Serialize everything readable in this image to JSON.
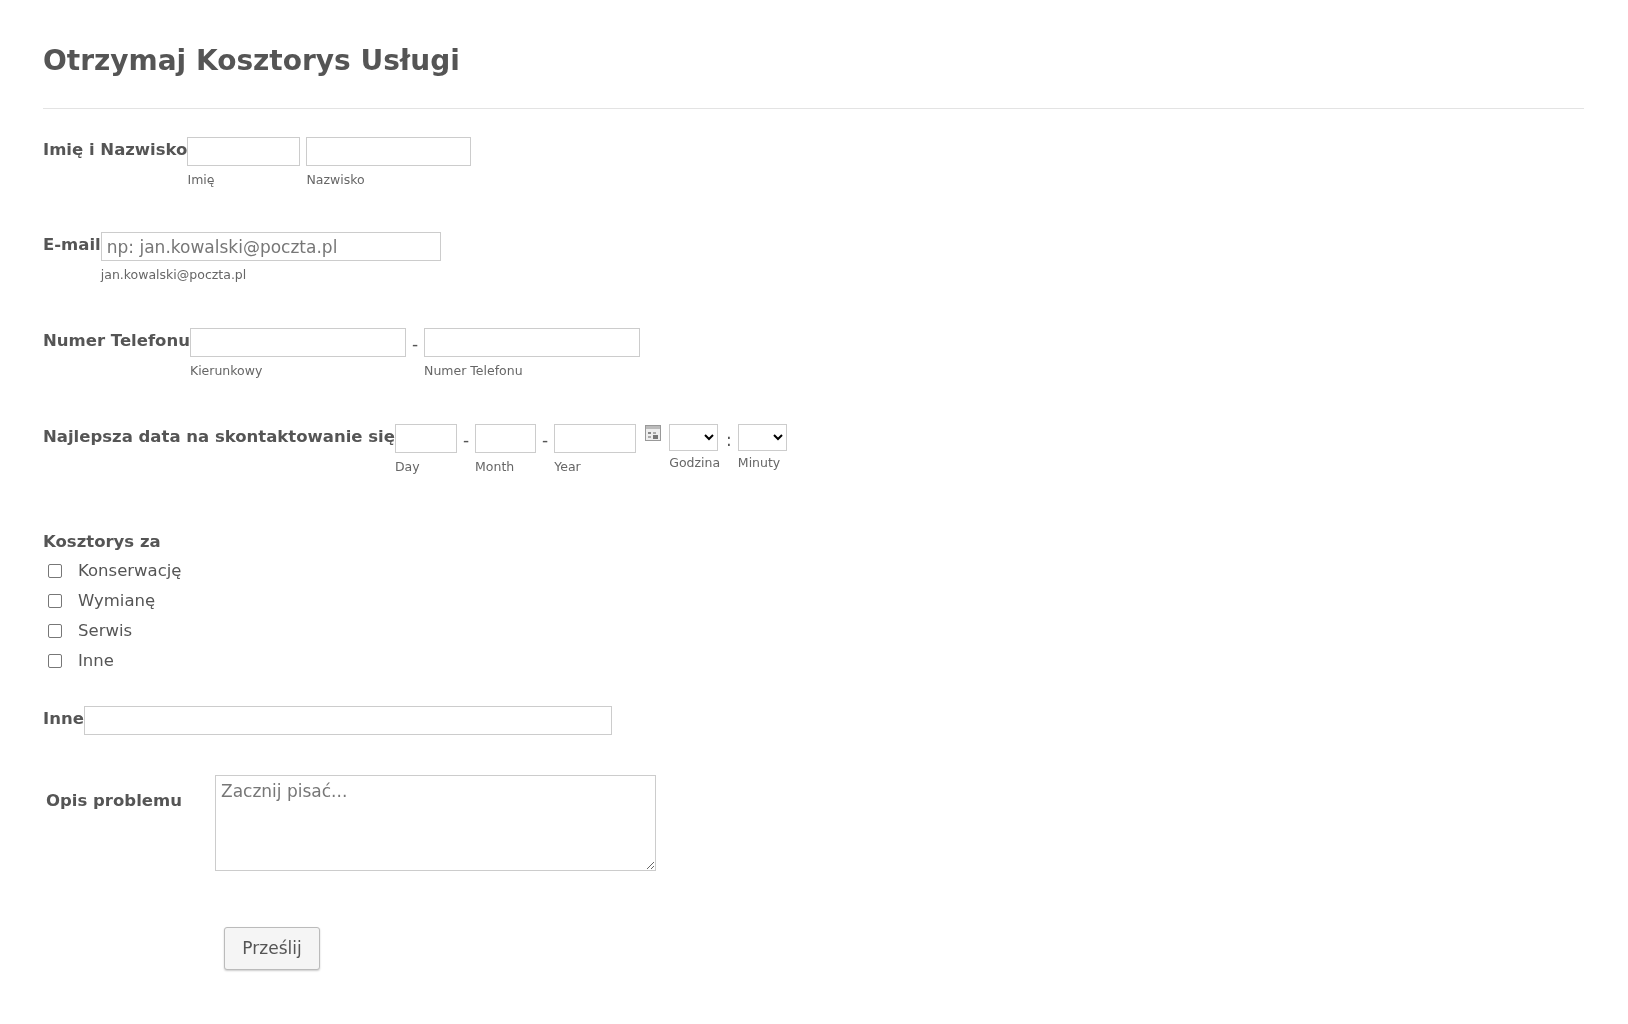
{
  "title": "Otrzymaj Kosztorys Usługi",
  "fields": [
    {
      "kind": "group",
      "label": "Imię i Nazwisko",
      "inputs": [
        {
          "sublabel": "Imię"
        },
        {
          "sublabel": "Nazwisko"
        }
      ]
    },
    {
      "kind": "group",
      "label": "E-mail",
      "inputs": [
        {
          "placeholder": "np: jan.kowalski@poczta.pl",
          "sublabel": "jan.kowalski@poczta.pl"
        }
      ]
    },
    {
      "kind": "group",
      "label": "Numer Telefonu",
      "separator": "-",
      "inputs": [
        {
          "sublabel": "Kierunkowy"
        },
        {
          "sublabel": "Numer Telefonu"
        }
      ]
    },
    {
      "kind": "date",
      "label": "Najlepsza data na skontaktowanie się",
      "separator": "-",
      "inputs": [
        {
          "sublabel": "Day"
        },
        {
          "sublabel": "Month"
        },
        {
          "sublabel": "Year"
        }
      ],
      "time_separator": ":",
      "time": [
        {
          "sublabel": "Godzina"
        },
        {
          "sublabel": "Minuty"
        }
      ]
    },
    {
      "kind": "checkboxes",
      "label": "Kosztorys za",
      "options": [
        {
          "label": "Konserwację",
          "checked": false
        },
        {
          "label": "Wymianę",
          "checked": false
        },
        {
          "label": "Serwis",
          "checked": false
        },
        {
          "label": "Inne",
          "checked": false
        }
      ]
    },
    {
      "kind": "text",
      "label": "Inne"
    },
    {
      "kind": "textarea",
      "label": "Opis problemu",
      "placeholder": "Zacznij pisać..."
    }
  ],
  "submit": "Prześlij"
}
